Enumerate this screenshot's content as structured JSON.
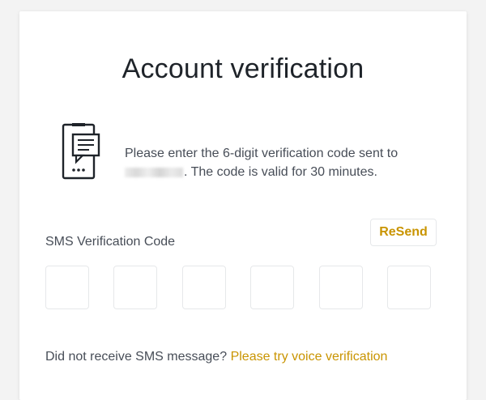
{
  "page": {
    "title": "Account verification"
  },
  "message": {
    "line_start": "Please enter the 6-digit verification code sent to",
    "line_end": ". The code is valid for 30 minutes."
  },
  "sms": {
    "label": "SMS Verification Code",
    "resend_label": "ReSend",
    "code_digits": [
      "",
      "",
      "",
      "",
      "",
      ""
    ]
  },
  "footer": {
    "prompt": "Did not receive SMS message?",
    "link": "Please try voice verification"
  },
  "colors": {
    "accent": "#c99400",
    "text_primary": "#1e2329",
    "text_secondary": "#474d57",
    "border": "#e6e8ea"
  },
  "icons": {
    "sms_phone": "phone-with-message-icon"
  }
}
